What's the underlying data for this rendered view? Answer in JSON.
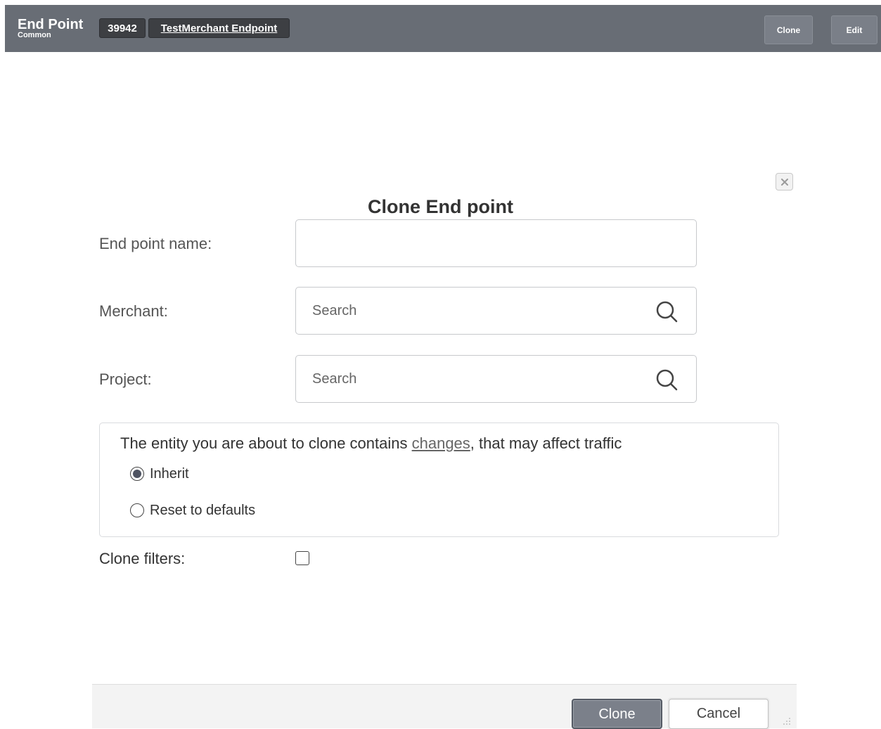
{
  "header": {
    "title": "End Point",
    "subtitle": "Common",
    "entity_id": "39942",
    "entity_name": "TestMerchant Endpoint",
    "clone_label": "Clone",
    "edit_label": "Edit"
  },
  "dialog": {
    "title": "Clone End point",
    "close_icon": "close-icon",
    "fields": {
      "name_label": "End point name:",
      "name_value": "",
      "merchant_label": "Merchant:",
      "merchant_placeholder": "Search",
      "project_label": "Project:",
      "project_placeholder": "Search",
      "search_icon": "search-icon"
    },
    "notice": {
      "text_before": "The entity you are about to clone contains ",
      "link_text": "changes",
      "text_after": ", that may affect traffic",
      "options": [
        {
          "label": "Inherit",
          "selected": true
        },
        {
          "label": "Reset to defaults",
          "selected": false
        }
      ]
    },
    "clone_filters_label": "Clone filters:",
    "clone_filters_checked": false,
    "buttons": {
      "clone": "Clone",
      "cancel": "Cancel"
    }
  },
  "colors": {
    "header_bg": "#686d75",
    "chip_bg": "#3d3f43",
    "primary_button": "#7b808a"
  }
}
